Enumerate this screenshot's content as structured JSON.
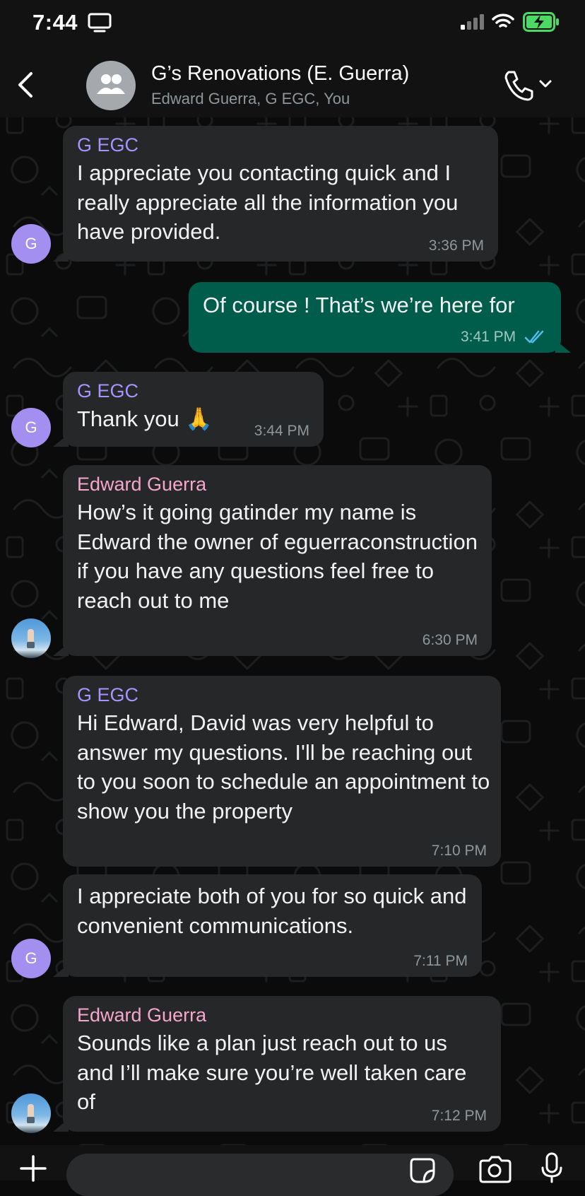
{
  "status_bar": {
    "time": "7:44"
  },
  "header": {
    "title": "G’s Renovations (E. Guerra)",
    "subtitle": "Edward Guerra, G EGC, You"
  },
  "messages": [
    {
      "direction": "in",
      "sender": "G EGC",
      "sender_color": "#a793ff",
      "avatar": "G",
      "text": "I appreciate you contacting quick and I really appreciate all the information you have provided.",
      "time": "3:36 PM"
    },
    {
      "direction": "out",
      "text": "Of course ! That’s we’re here for",
      "time": "3:41 PM",
      "status": "read"
    },
    {
      "direction": "in",
      "sender": "G EGC",
      "sender_color": "#a793ff",
      "avatar": "G",
      "text": "Thank you 🙏",
      "time": "3:44 PM"
    },
    {
      "direction": "in",
      "sender": "Edward Guerra",
      "sender_color": "#f6a5cf",
      "avatar": "photo",
      "text": "How’s it going gatinder my name is Edward the owner of eguerraconstruction if you have any questions feel free to reach out to me",
      "time": "6:30 PM"
    },
    {
      "direction": "in",
      "sender": "G EGC",
      "sender_color": "#a793ff",
      "text": "Hi Edward, David was very helpful to answer my questions. I'll be reaching out to you soon to schedule an appointment to show you the property",
      "time": "7:10 PM"
    },
    {
      "direction": "in",
      "avatar": "G",
      "text": "I appreciate both of you for so quick and convenient communications.",
      "time": "7:11 PM"
    },
    {
      "direction": "in",
      "sender": "Edward Guerra",
      "sender_color": "#f6a5cf",
      "avatar": "photo",
      "text": "Sounds like a plan just reach out to us and I’ll make sure you’re well taken care of",
      "time": "7:12 PM"
    }
  ],
  "colors": {
    "incoming_bubble": "#262729",
    "outgoing_bubble": "#005c4b",
    "read_ticks": "#53bdeb",
    "avatar_letter_bg": "#a38ff0"
  },
  "icons": [
    "tv-icon",
    "signal-icon",
    "wifi-icon",
    "battery-charging-icon",
    "back-chevron-icon",
    "group-icon",
    "phone-icon",
    "chevron-down-icon",
    "plus-icon",
    "sticker-icon",
    "camera-icon",
    "mic-icon",
    "double-check-icon"
  ]
}
